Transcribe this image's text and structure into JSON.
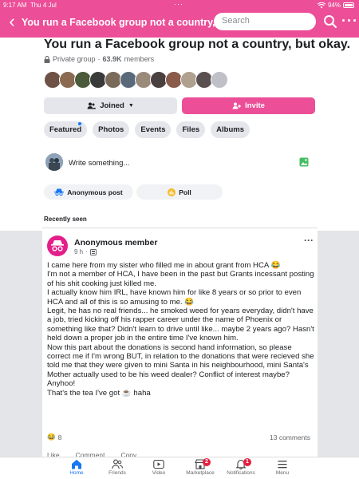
{
  "status_bar": {
    "time": "9:17 AM",
    "date": "Thu 4 Jul",
    "battery": "94%"
  },
  "app_bar": {
    "title": "You run a Facebook group not a country, but okay.",
    "search_placeholder": "Search"
  },
  "group": {
    "name": "You run a Facebook group not a country, but okay.",
    "privacy": "Private group",
    "separator": "·",
    "member_count": "63.9K",
    "members_label": "members",
    "member_avatar_colors": [
      "#6d5245",
      "#8a6a50",
      "#4b5a3a",
      "#3a3a3a",
      "#7a6a5a",
      "#5a6a7a",
      "#9a8a7a",
      "#4a4040",
      "#8a5a4a",
      "#b0a090",
      "#5a5050",
      "#c0c0c8"
    ],
    "joined_label": "Joined",
    "invite_label": "Invite",
    "tabs": [
      "Featured",
      "Photos",
      "Events",
      "Files",
      "Albums"
    ],
    "composer_placeholder": "Write something...",
    "anonymous_post_label": "Anonymous post",
    "poll_label": "Poll",
    "recently_seen_label": "Recently seen"
  },
  "post": {
    "author": "Anonymous member",
    "time": "9 h",
    "meta_separator": "·",
    "paragraphs": [
      "I came here from my sister who filled me in about grant from HCA 😂",
      "I'm not a member of HCA, I have been in the past but Grants incessant posting of his shit cooking just killed me.",
      "I actually know him IRL, have known him for like 8 years or so prior to even HCA and all of this is so amusing to me. 😂",
      "Legit, he has no real friends... he smoked weed for years everyday, didn't have a job, tried kicking off his rapper career under the name of Phoenix or something like that? Didn't learn to drive until like... maybe 2 years ago? Hasn't held down a proper job in the entire time I've known him.",
      "Now this part about the donations is second hand information, so please correct me if I'm wrong BUT, in relation to the donations that were recieved she told me that they were given to mini Santa in his neighbourhood, mini Santa's Mother actually used to be his weed dealer? Conflict of interest maybe?",
      "Anyhoo!",
      "That's the tea I've got ☕ haha"
    ],
    "reaction_emoji": "😂",
    "reaction_count": "8",
    "comments_label": "13 comments",
    "actions": [
      "Like",
      "Comment",
      "Copy"
    ]
  },
  "bottom_nav": [
    {
      "label": "Home",
      "icon": "home-icon",
      "active": true
    },
    {
      "label": "Friends",
      "icon": "friends-icon",
      "active": false
    },
    {
      "label": "Video",
      "icon": "video-icon",
      "active": false
    },
    {
      "label": "Marketplace",
      "icon": "marketplace-icon",
      "badge": "2",
      "active": false
    },
    {
      "label": "Notifications",
      "icon": "bell-icon",
      "badge": "1",
      "active": false
    },
    {
      "label": "Menu",
      "icon": "menu-icon",
      "active": false
    }
  ],
  "colors": {
    "accent_pink": "#ec4e98",
    "facebook_blue": "#1877f2",
    "badge_red": "#e41e3f"
  }
}
